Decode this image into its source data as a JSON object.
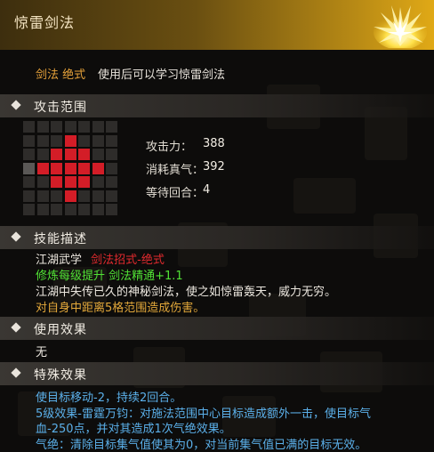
{
  "header": {
    "title": "惊雷剑法"
  },
  "subtitle": {
    "tag": "剑法 绝式",
    "desc": "使用后可以学习惊雷剑法"
  },
  "sections": {
    "range": "攻击范围",
    "skill_desc": "技能描述",
    "use_effect": "使用效果",
    "special_effect": "特殊效果"
  },
  "range_grid": {
    "size": 7,
    "hit_cells": [
      [
        1,
        3
      ],
      [
        2,
        2
      ],
      [
        2,
        3
      ],
      [
        2,
        4
      ],
      [
        3,
        1
      ],
      [
        3,
        2
      ],
      [
        3,
        3
      ],
      [
        3,
        4
      ],
      [
        3,
        5
      ],
      [
        4,
        2
      ],
      [
        4,
        3
      ],
      [
        4,
        4
      ],
      [
        5,
        3
      ]
    ],
    "self_cell": [
      3,
      0
    ],
    "colors": {
      "hit": "#d31d27",
      "empty": "#2e2c2a",
      "self": "#5a5856"
    }
  },
  "stats": [
    {
      "label": "攻击力：",
      "value": "388"
    },
    {
      "label": "消耗真气：",
      "value": "392"
    },
    {
      "label": "等待回合：",
      "value": "4"
    }
  ],
  "skill_desc": {
    "line1_prefix": "江湖武学",
    "line1_red": "剑法招式-绝式",
    "line2": "修炼每级提升 剑法精通+1.1",
    "line3": "江湖中失传已久的神秘剑法，使之如惊雷轰天，威力无穷。",
    "line4": "对自身中距离5格范围造成伤害。"
  },
  "use_effect": {
    "text": "无"
  },
  "special_effect": {
    "line1": "使目标移动-2，持续2回合。",
    "line2": "5级效果-雷霆万钧：对施法范围中心目标造成额外一击，使目标气",
    "line3": "血-250点，并对其造成1次气绝效果。",
    "line4": "气绝：清除目标集气值使其为0，对当前集气值已满的目标无效。"
  },
  "colors": {
    "accent_gold": "#e0a916",
    "hit_red": "#d31d27",
    "green": "#51e235",
    "blue": "#5bb0ea"
  }
}
